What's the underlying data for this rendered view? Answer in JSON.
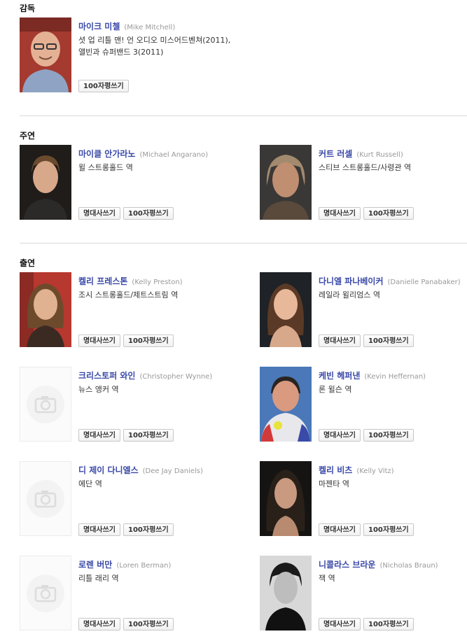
{
  "sections": {
    "director": {
      "title": "감독"
    },
    "lead": {
      "title": "주연"
    },
    "support": {
      "title": "출연"
    }
  },
  "buttons": {
    "quote": "명대사쓰기",
    "review": "100자평쓰기"
  },
  "director": {
    "name": "마이크 미첼",
    "orig": "(Mike Mitchell)",
    "role1": "셧 업 리틀 맨! 언 오디오 미스어드벤쳐(2011),",
    "role2": "앨빈과 슈퍼밴드 3(2011)"
  },
  "lead": [
    {
      "name": "마이클 안가라노",
      "orig": "(Michael Angarano)",
      "role": "윌 스트롱홀드 역"
    },
    {
      "name": "커트 러셀",
      "orig": "(Kurt Russell)",
      "role": "스티브 스트롱홀드/사령관 역"
    }
  ],
  "support": [
    {
      "name": "켈리 프레스톤",
      "orig": "(Kelly Preston)",
      "role": "조시 스트롱홀드/제트스트림 역"
    },
    {
      "name": "다니엘 파나베이커",
      "orig": "(Danielle Panabaker)",
      "role": "레일라 윌리엄스 역"
    },
    {
      "name": "크리스토퍼 와인",
      "orig": "(Christopher Wynne)",
      "role": "뉴스 앵커 역"
    },
    {
      "name": "케빈 헤퍼낸",
      "orig": "(Kevin Heffernan)",
      "role": "론 윌슨 역"
    },
    {
      "name": "디 제이 다니엘스",
      "orig": "(Dee Jay Daniels)",
      "role": "에단 역"
    },
    {
      "name": "켈리 비츠",
      "orig": "(Kelly Vitz)",
      "role": "마젠타 역"
    },
    {
      "name": "로렌 버만",
      "orig": "(Loren Berman)",
      "role": "리틀 래리 역"
    },
    {
      "name": "니콜라스 브라운",
      "orig": "(Nicholas Braun)",
      "role": "잭 역"
    }
  ]
}
